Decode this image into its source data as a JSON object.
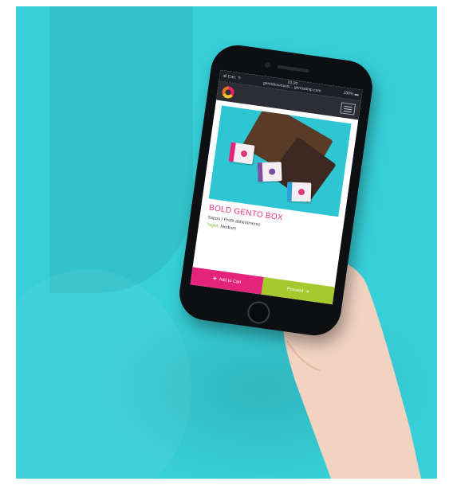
{
  "scene": {
    "background_color": "#37cfd8",
    "phone_color": "#0e0f12"
  },
  "status_bar": {
    "carrier": "all Carr. ᯤ",
    "time": "01:20",
    "url": "gentoboxmusic... genoaship.com",
    "battery": "100% ▬"
  },
  "app_bar": {
    "logo_icon": "g-logo-icon",
    "menu_icon": "hamburger-menu-icon"
  },
  "product": {
    "title": "BOLD GENTO BOX",
    "subtitle": "Sapori / Profit abbinamento",
    "size_label": "Taglia:",
    "size_value": "Medium"
  },
  "actions": {
    "add_to_cart_icon": "plus-icon",
    "add_to_cart_label": "Add to Cart",
    "next_label": "Proceed",
    "next_icon": "arrow-right-icon"
  },
  "colors": {
    "accent_pink": "#e4247b",
    "accent_green": "#a6c92d",
    "title_pink": "#e5317c"
  }
}
